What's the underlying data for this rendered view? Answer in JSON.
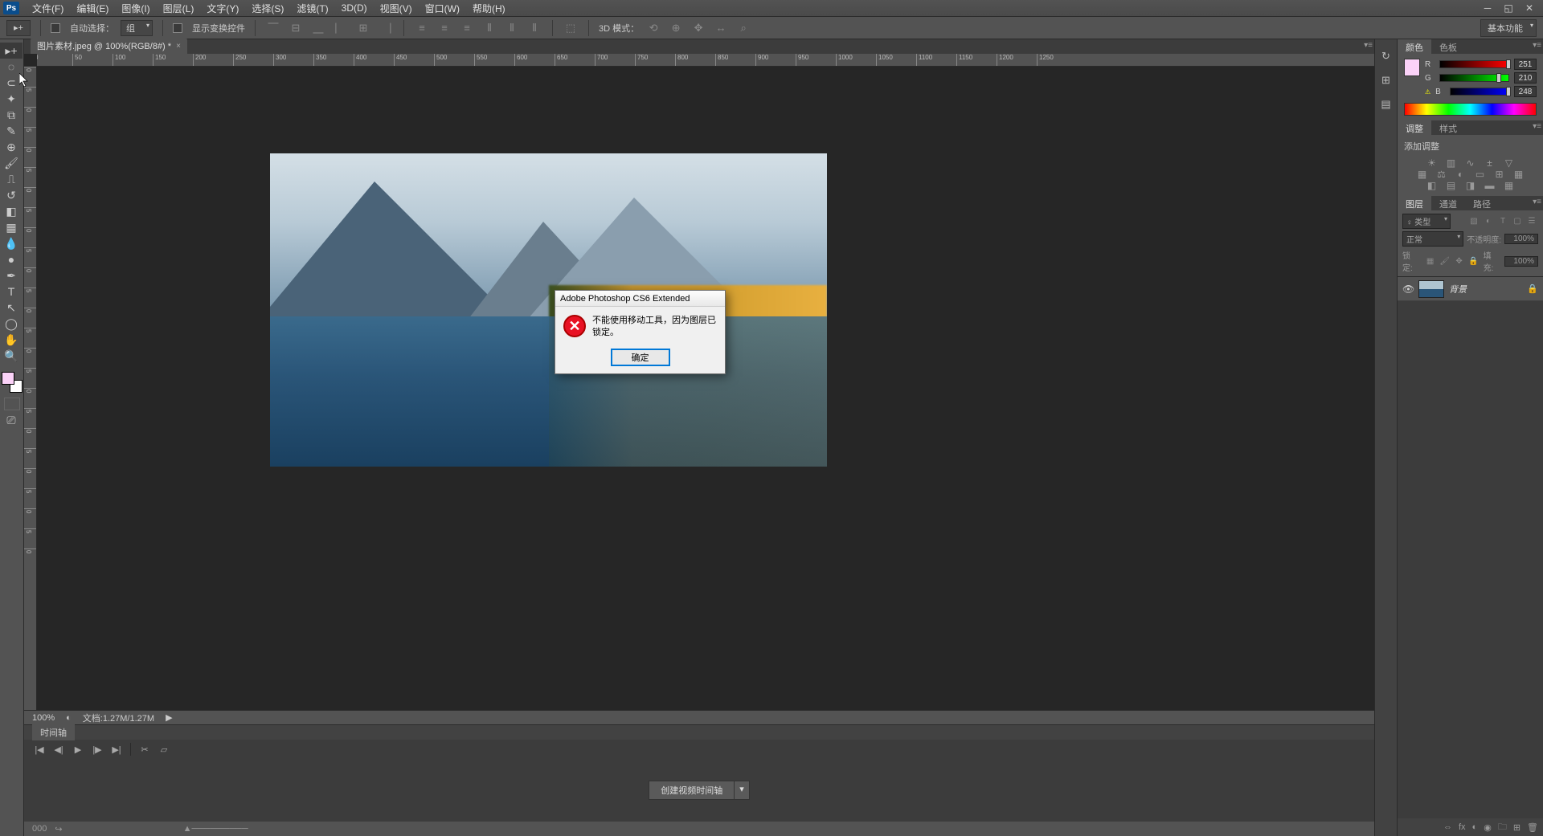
{
  "logo": "Ps",
  "menu": {
    "file": "文件(F)",
    "edit": "编辑(E)",
    "image": "图像(I)",
    "layer": "图层(L)",
    "type": "文字(Y)",
    "select": "选择(S)",
    "filter": "滤镜(T)",
    "3d": "3D(D)",
    "view": "视图(V)",
    "window": "窗口(W)",
    "help": "帮助(H)"
  },
  "options": {
    "auto_select": "自动选择：",
    "auto_select_value": "组",
    "show_transform": "显示变换控件",
    "mode_3d": "3D 模式：",
    "workspace": "基本功能"
  },
  "doc": {
    "tab": "图片素材.jpeg @ 100%(RGB/8#) *",
    "zoom": "100%",
    "status": "文档:1.27M/1.27M"
  },
  "ruler_ticks_h": [
    "0",
    "50",
    "100",
    "150",
    "200",
    "250",
    "300",
    "350",
    "400",
    "450",
    "500",
    "550",
    "600",
    "650",
    "700",
    "750",
    "800",
    "850",
    "900",
    "950",
    "1000",
    "1050",
    "1100",
    "1150",
    "1200",
    "1250"
  ],
  "ruler_ticks_v": [
    "0",
    "5",
    "0",
    "5",
    "0",
    "5",
    "0",
    "5",
    "0",
    "5",
    "0",
    "5",
    "0",
    "5",
    "0",
    "5",
    "0",
    "5",
    "0",
    "5",
    "0",
    "5",
    "0",
    "5",
    "0"
  ],
  "timeline": {
    "tab": "时间轴",
    "create": "创建视频时间轴",
    "footer": "000"
  },
  "panels": {
    "color_tab": "颜色",
    "swatches_tab": "色板",
    "adjust_tab": "调整",
    "styles_tab": "样式",
    "adjust_title": "添加调整",
    "layers_tab": "图层",
    "channels_tab": "通道",
    "paths_tab": "路径"
  },
  "color": {
    "r_label": "R",
    "r_value": "251",
    "g_label": "G",
    "g_value": "210",
    "b_label": "B",
    "b_value": "248"
  },
  "layers": {
    "kind": "♀ 类型",
    "blend": "正常",
    "opacity_label": "不透明度:",
    "opacity_value": "100%",
    "lock_label": "锁定:",
    "fill_label": "填充:",
    "fill_value": "100%",
    "layer1_name": "背景"
  },
  "dialog": {
    "title": "Adobe Photoshop CS6 Extended",
    "message": "不能使用移动工具，因为图层已锁定。",
    "ok": "确定"
  }
}
